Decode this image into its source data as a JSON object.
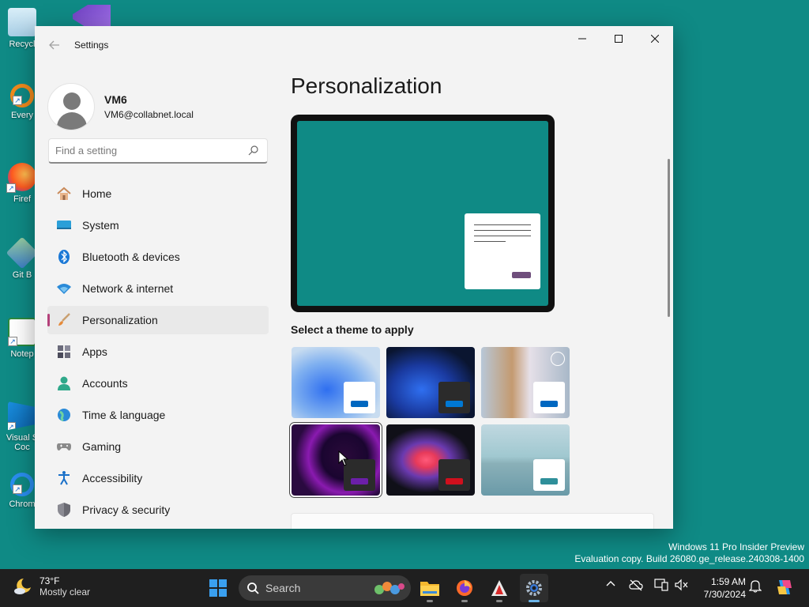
{
  "desktop": {
    "icons": [
      {
        "label": "Recycl"
      },
      {
        "label": "Every"
      },
      {
        "label": "Firef"
      },
      {
        "label": "Git B"
      },
      {
        "label": "Notep"
      },
      {
        "label": "Visual S Coc"
      },
      {
        "label": "Chrom"
      }
    ],
    "watermark": {
      "line1": "Windows 11 Pro Insider Preview",
      "line2": "Evaluation copy. Build 26080.ge_release.240308-1400"
    }
  },
  "window": {
    "title": "Settings",
    "profile": {
      "name": "VM6",
      "email": "VM6@collabnet.local"
    },
    "search": {
      "placeholder": "Find a setting"
    },
    "nav": [
      {
        "label": "Home",
        "icon": "home-icon"
      },
      {
        "label": "System",
        "icon": "system-icon"
      },
      {
        "label": "Bluetooth & devices",
        "icon": "bluetooth-icon"
      },
      {
        "label": "Network & internet",
        "icon": "wifi-icon"
      },
      {
        "label": "Personalization",
        "icon": "brush-icon",
        "active": true
      },
      {
        "label": "Apps",
        "icon": "apps-icon"
      },
      {
        "label": "Accounts",
        "icon": "account-icon"
      },
      {
        "label": "Time & language",
        "icon": "globe-icon"
      },
      {
        "label": "Gaming",
        "icon": "gamepad-icon"
      },
      {
        "label": "Accessibility",
        "icon": "accessibility-icon"
      },
      {
        "label": "Privacy & security",
        "icon": "shield-icon"
      }
    ],
    "content": {
      "title": "Personalization",
      "theme_heading": "Select a theme to apply",
      "themes": [
        {
          "name": "windows-light",
          "accent": "#0067c0"
        },
        {
          "name": "windows-dark",
          "accent": "#0078d4"
        },
        {
          "name": "spotlight",
          "accent": "#0067c0"
        },
        {
          "name": "glow",
          "accent": "#6b1fa8",
          "selected": true
        },
        {
          "name": "captured-motion",
          "accent": "#d0101d"
        },
        {
          "name": "flow",
          "accent": "#2f8f9a"
        }
      ]
    }
  },
  "taskbar": {
    "weather": {
      "temp": "73°F",
      "desc": "Mostly clear"
    },
    "search_label": "Search",
    "clock": {
      "time": "1:59 AM",
      "date": "7/30/2024"
    }
  }
}
